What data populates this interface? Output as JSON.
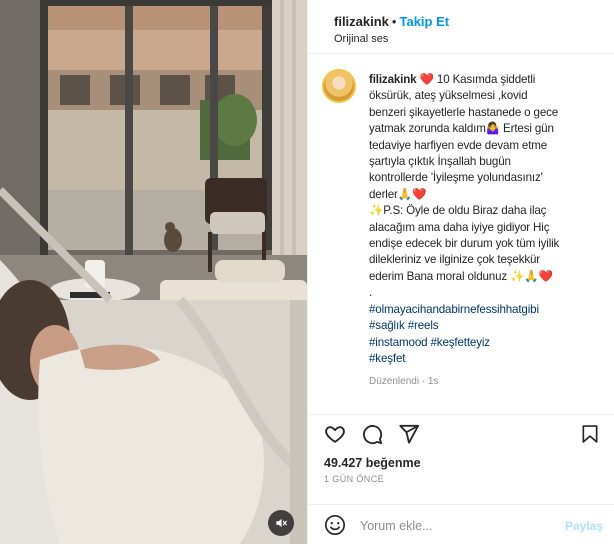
{
  "header": {
    "username": "filizakink",
    "separator": "•",
    "follow_label": "Takip Et",
    "audio_label": "Orijinal ses"
  },
  "post": {
    "username": "filizakink",
    "caption_lines": [
      "❤️ 10 Kasımda şiddetli",
      "öksürük, ateş yükselmesi ,kovid",
      "benzeri şikayetlerle hastanede o gece",
      "yatmak zorunda kaldım🤷‍♀️ Ertesi gün",
      "tedaviye harfiyen evde devam etme",
      "şartıyla çıktık İnşallah bugün",
      "kontrollerde 'İyileşme yolundasınız'",
      "derler🙏❤️",
      "✨P.S: Öyle de oldu Biraz daha ilaç",
      "alacağım ama daha iyiye gidiyor Hiç",
      "endişe edecek bir durum yok tüm iyilik",
      "dilekleriniz ve ilginize çok teşekkür",
      "ederim Bana moral oldunuz ✨🙏❤️",
      "."
    ],
    "hashtags": [
      "#olmayacihandabirnefessihhatgibi",
      "#sağlık #reels",
      "#instamood #keşfetteyiz",
      "#keşfet"
    ],
    "edited": "Düzenlendi · 1s",
    "likes": "49.427 beğenme",
    "time": "1 GÜN ÖNCE"
  },
  "comment": {
    "placeholder": "Yorum ekle...",
    "post_label": "Paylaş"
  },
  "icons": {
    "like": "heart-icon",
    "comment": "comment-icon",
    "share": "paper-plane-icon",
    "save": "bookmark-icon",
    "emoji": "smiley-icon",
    "mute": "speaker-muted-icon"
  },
  "colors": {
    "accent": "#0095f6",
    "hashtag": "#00376b",
    "muted_text": "#8e8e8e",
    "post_disabled": "#b2dffc"
  }
}
